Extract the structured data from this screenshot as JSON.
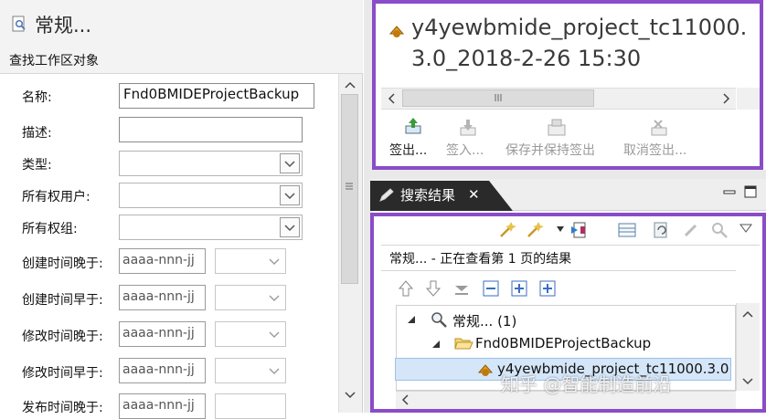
{
  "left_panel": {
    "title": "常规...",
    "subtitle": "查找工作区对象",
    "fields": [
      {
        "label": "名称:",
        "value": "Fnd0BMIDEProjectBackup"
      },
      {
        "label": "描述:",
        "value": ""
      },
      {
        "label": "类型:",
        "value": ""
      },
      {
        "label": "所有权用户:",
        "value": ""
      },
      {
        "label": "所有权组:",
        "value": ""
      },
      {
        "label": "创建时间晚于:",
        "date_placeholder": "aaaa-nnn-jj"
      },
      {
        "label": "创建时间早于:",
        "date_placeholder": "aaaa-nnn-jj"
      },
      {
        "label": "修改时间晚于:",
        "date_placeholder": "aaaa-nnn-jj"
      },
      {
        "label": "修改时间早于:",
        "date_placeholder": "aaaa-nnn-jj"
      },
      {
        "label": "发布时间晚于:",
        "date_placeholder": "aaaa-nnn-jj"
      }
    ]
  },
  "project_view": {
    "name_line1": "y4yewbmide_project_tc11000.",
    "name_line2": "3.0_2018-2-26 15:30",
    "toolbar": [
      {
        "label": "签出...",
        "enabled": true
      },
      {
        "label": "签入...",
        "enabled": false
      },
      {
        "label": "保存并保持签出",
        "enabled": false
      },
      {
        "label": "取消签出...",
        "enabled": false
      }
    ]
  },
  "search_results": {
    "tab_label": "搜索结果",
    "tab_close": "✕",
    "status": "常规... - 正在查看第 1 页的结果",
    "tree": {
      "root": "常规... (1)",
      "child": "Fnd0BMIDEProjectBackup",
      "leaf": "y4yewbmide_project_tc11000.3.0"
    }
  },
  "watermark": "知乎 @智能制造前沿",
  "colors": {
    "accent_border": "#8a4cc8",
    "selection_bg": "#d4e6f8",
    "tab_bg": "#2a2a2a"
  }
}
